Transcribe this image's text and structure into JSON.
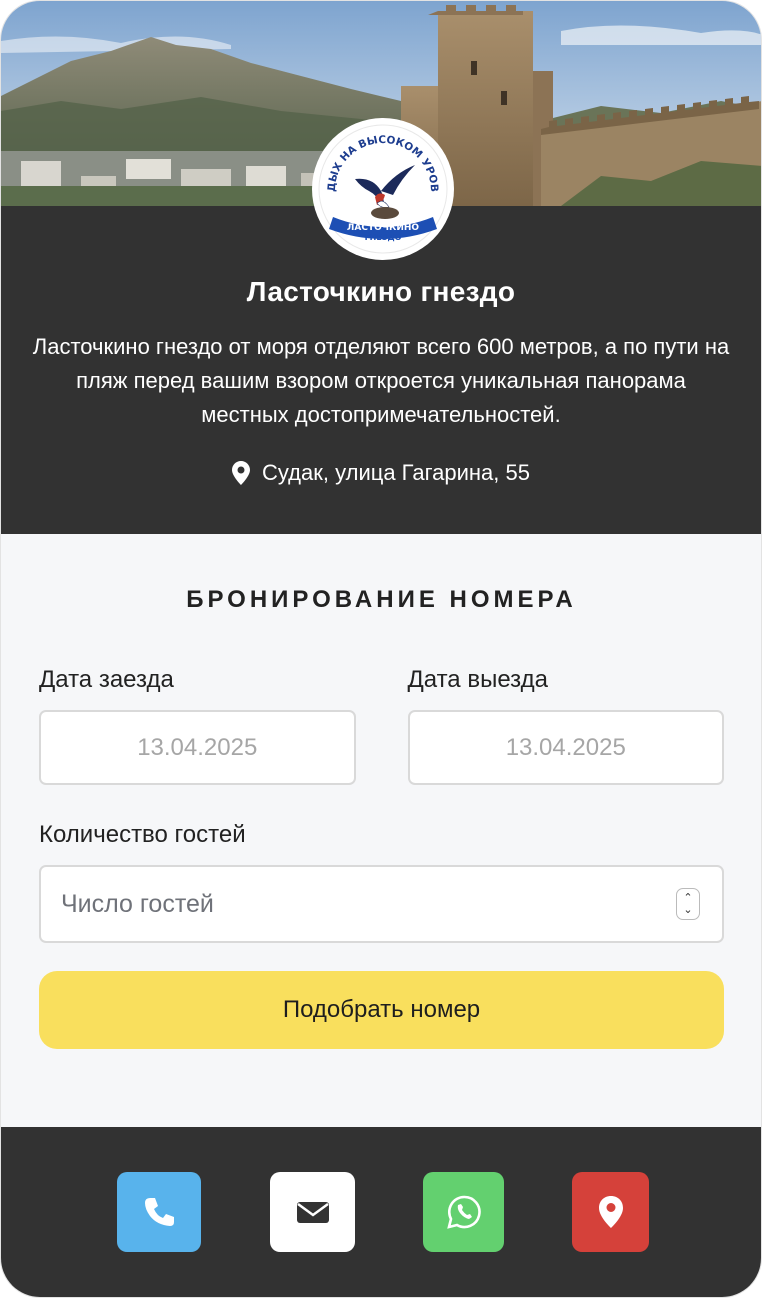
{
  "hero": {
    "image_alt": "Судак, Генуэзская крепость",
    "logo_top_text": "ОТДЫХ НА ВЫСОКОМ УРОВНЕ",
    "logo_ribbon_line1": "ЛАСТОЧКИНО",
    "logo_ribbon_line2": "ГНЕЗДО"
  },
  "info": {
    "title": "Ласточкино гнездо",
    "description": "Ласточкино гнездо от моря отделяют всего 600 метров, а по пути на пляж перед вашим взором откроется уникальная панорама местных достопримечательностей.",
    "address": "Судак, улица Гагарина, 55",
    "address_icon": "map-marker-icon"
  },
  "booking": {
    "heading": "БРОНИРОВАНИЕ НОМЕРА",
    "checkin_label": "Дата заезда",
    "checkin_value": "13.04.2025",
    "checkout_label": "Дата выезда",
    "checkout_value": "13.04.2025",
    "guests_label": "Количество гостей",
    "guests_placeholder": "Число гостей",
    "submit_label": "Подобрать номер"
  },
  "footer": {
    "buttons": [
      {
        "icon": "phone-icon",
        "color": "#58b3ec"
      },
      {
        "icon": "envelope-icon",
        "color": "#ffffff"
      },
      {
        "icon": "whatsapp-icon",
        "color": "#63d06f"
      },
      {
        "icon": "map-marker-icon",
        "color": "#d5413a"
      }
    ]
  },
  "colors": {
    "dark": "#323232",
    "accent_button": "#f9df5d",
    "page_bg": "#f6f7f9"
  }
}
